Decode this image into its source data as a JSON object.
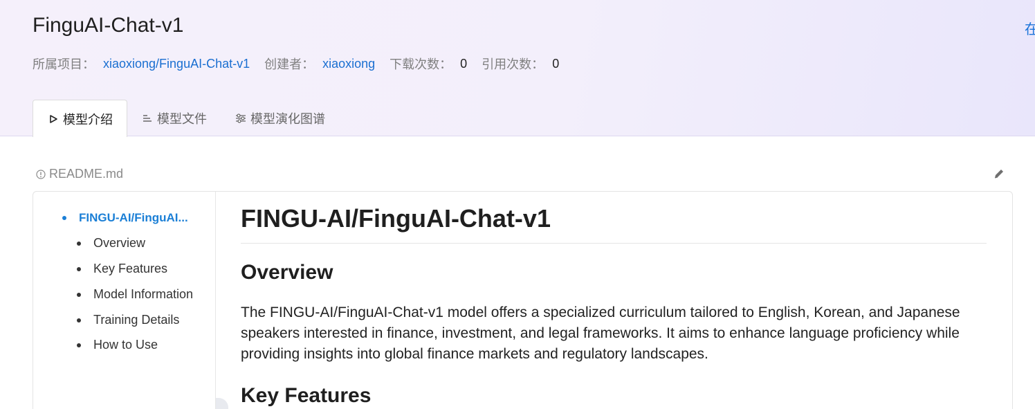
{
  "header": {
    "title": "FinguAI-Chat-v1",
    "top_right_link": "在",
    "meta": {
      "project_label": "所属项目：",
      "project_value": "xiaoxiong/FinguAI-Chat-v1",
      "creator_label": "创建者：",
      "creator_value": "xiaoxiong",
      "downloads_label": "下载次数：",
      "downloads_value": "0",
      "citations_label": "引用次数：",
      "citations_value": "0"
    },
    "tabs": [
      {
        "label": "模型介绍",
        "icon": "play-outline-icon",
        "active": true
      },
      {
        "label": "模型文件",
        "icon": "file-list-icon",
        "active": false
      },
      {
        "label": "模型演化图谱",
        "icon": "sliders-icon",
        "active": false
      }
    ]
  },
  "readme": {
    "label": "README.md",
    "icon": "info-circle-icon",
    "edit_icon": "pencil-icon"
  },
  "toc": {
    "main": "FINGU-AI/FinguAI...",
    "items": [
      "Overview",
      "Key Features",
      "Model Information",
      "Training Details",
      "How to Use"
    ]
  },
  "content": {
    "h1": "FINGU-AI/FinguAI-Chat-v1",
    "overview_heading": "Overview",
    "overview_text": "The FINGU-AI/FinguAI-Chat-v1 model offers a specialized curriculum tailored to English, Korean, and Japanese speakers interested in finance, investment, and legal frameworks. It aims to enhance language proficiency while providing insights into global finance markets and regulatory landscapes.",
    "key_features_heading": "Key Features"
  },
  "colors": {
    "link": "#1a6fd1",
    "toc_active": "#1b7fd6",
    "header_bg": "#f4f0fb"
  }
}
